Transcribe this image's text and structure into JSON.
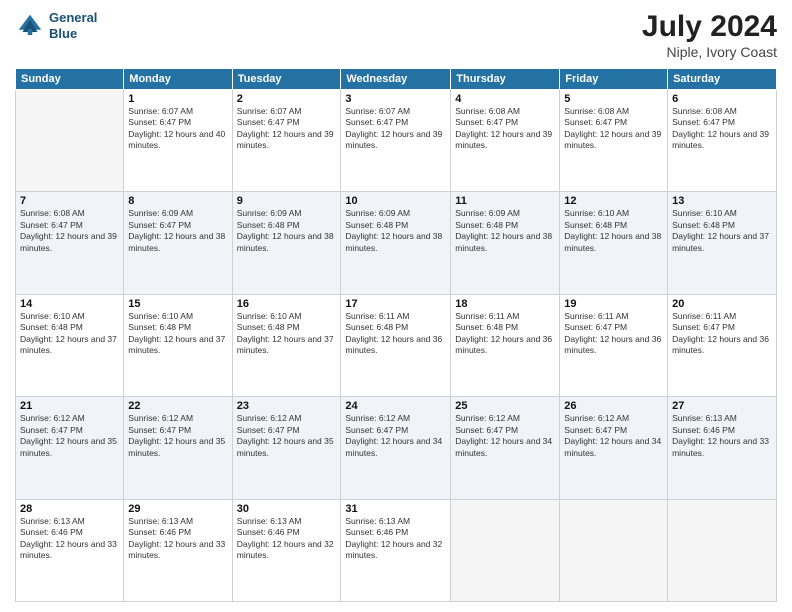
{
  "header": {
    "logo_line1": "General",
    "logo_line2": "Blue",
    "month_year": "July 2024",
    "location": "Niple, Ivory Coast"
  },
  "days_of_week": [
    "Sunday",
    "Monday",
    "Tuesday",
    "Wednesday",
    "Thursday",
    "Friday",
    "Saturday"
  ],
  "weeks": [
    [
      {
        "day": "",
        "sunrise": "",
        "sunset": "",
        "daylight": "",
        "empty": true
      },
      {
        "day": "1",
        "sunrise": "Sunrise: 6:07 AM",
        "sunset": "Sunset: 6:47 PM",
        "daylight": "Daylight: 12 hours and 40 minutes."
      },
      {
        "day": "2",
        "sunrise": "Sunrise: 6:07 AM",
        "sunset": "Sunset: 6:47 PM",
        "daylight": "Daylight: 12 hours and 39 minutes."
      },
      {
        "day": "3",
        "sunrise": "Sunrise: 6:07 AM",
        "sunset": "Sunset: 6:47 PM",
        "daylight": "Daylight: 12 hours and 39 minutes."
      },
      {
        "day": "4",
        "sunrise": "Sunrise: 6:08 AM",
        "sunset": "Sunset: 6:47 PM",
        "daylight": "Daylight: 12 hours and 39 minutes."
      },
      {
        "day": "5",
        "sunrise": "Sunrise: 6:08 AM",
        "sunset": "Sunset: 6:47 PM",
        "daylight": "Daylight: 12 hours and 39 minutes."
      },
      {
        "day": "6",
        "sunrise": "Sunrise: 6:08 AM",
        "sunset": "Sunset: 6:47 PM",
        "daylight": "Daylight: 12 hours and 39 minutes."
      }
    ],
    [
      {
        "day": "7",
        "sunrise": "Sunrise: 6:08 AM",
        "sunset": "Sunset: 6:47 PM",
        "daylight": "Daylight: 12 hours and 39 minutes."
      },
      {
        "day": "8",
        "sunrise": "Sunrise: 6:09 AM",
        "sunset": "Sunset: 6:47 PM",
        "daylight": "Daylight: 12 hours and 38 minutes."
      },
      {
        "day": "9",
        "sunrise": "Sunrise: 6:09 AM",
        "sunset": "Sunset: 6:48 PM",
        "daylight": "Daylight: 12 hours and 38 minutes."
      },
      {
        "day": "10",
        "sunrise": "Sunrise: 6:09 AM",
        "sunset": "Sunset: 6:48 PM",
        "daylight": "Daylight: 12 hours and 38 minutes."
      },
      {
        "day": "11",
        "sunrise": "Sunrise: 6:09 AM",
        "sunset": "Sunset: 6:48 PM",
        "daylight": "Daylight: 12 hours and 38 minutes."
      },
      {
        "day": "12",
        "sunrise": "Sunrise: 6:10 AM",
        "sunset": "Sunset: 6:48 PM",
        "daylight": "Daylight: 12 hours and 38 minutes."
      },
      {
        "day": "13",
        "sunrise": "Sunrise: 6:10 AM",
        "sunset": "Sunset: 6:48 PM",
        "daylight": "Daylight: 12 hours and 37 minutes."
      }
    ],
    [
      {
        "day": "14",
        "sunrise": "Sunrise: 6:10 AM",
        "sunset": "Sunset: 6:48 PM",
        "daylight": "Daylight: 12 hours and 37 minutes."
      },
      {
        "day": "15",
        "sunrise": "Sunrise: 6:10 AM",
        "sunset": "Sunset: 6:48 PM",
        "daylight": "Daylight: 12 hours and 37 minutes."
      },
      {
        "day": "16",
        "sunrise": "Sunrise: 6:10 AM",
        "sunset": "Sunset: 6:48 PM",
        "daylight": "Daylight: 12 hours and 37 minutes."
      },
      {
        "day": "17",
        "sunrise": "Sunrise: 6:11 AM",
        "sunset": "Sunset: 6:48 PM",
        "daylight": "Daylight: 12 hours and 36 minutes."
      },
      {
        "day": "18",
        "sunrise": "Sunrise: 6:11 AM",
        "sunset": "Sunset: 6:48 PM",
        "daylight": "Daylight: 12 hours and 36 minutes."
      },
      {
        "day": "19",
        "sunrise": "Sunrise: 6:11 AM",
        "sunset": "Sunset: 6:47 PM",
        "daylight": "Daylight: 12 hours and 36 minutes."
      },
      {
        "day": "20",
        "sunrise": "Sunrise: 6:11 AM",
        "sunset": "Sunset: 6:47 PM",
        "daylight": "Daylight: 12 hours and 36 minutes."
      }
    ],
    [
      {
        "day": "21",
        "sunrise": "Sunrise: 6:12 AM",
        "sunset": "Sunset: 6:47 PM",
        "daylight": "Daylight: 12 hours and 35 minutes."
      },
      {
        "day": "22",
        "sunrise": "Sunrise: 6:12 AM",
        "sunset": "Sunset: 6:47 PM",
        "daylight": "Daylight: 12 hours and 35 minutes."
      },
      {
        "day": "23",
        "sunrise": "Sunrise: 6:12 AM",
        "sunset": "Sunset: 6:47 PM",
        "daylight": "Daylight: 12 hours and 35 minutes."
      },
      {
        "day": "24",
        "sunrise": "Sunrise: 6:12 AM",
        "sunset": "Sunset: 6:47 PM",
        "daylight": "Daylight: 12 hours and 34 minutes."
      },
      {
        "day": "25",
        "sunrise": "Sunrise: 6:12 AM",
        "sunset": "Sunset: 6:47 PM",
        "daylight": "Daylight: 12 hours and 34 minutes."
      },
      {
        "day": "26",
        "sunrise": "Sunrise: 6:12 AM",
        "sunset": "Sunset: 6:47 PM",
        "daylight": "Daylight: 12 hours and 34 minutes."
      },
      {
        "day": "27",
        "sunrise": "Sunrise: 6:13 AM",
        "sunset": "Sunset: 6:46 PM",
        "daylight": "Daylight: 12 hours and 33 minutes."
      }
    ],
    [
      {
        "day": "28",
        "sunrise": "Sunrise: 6:13 AM",
        "sunset": "Sunset: 6:46 PM",
        "daylight": "Daylight: 12 hours and 33 minutes."
      },
      {
        "day": "29",
        "sunrise": "Sunrise: 6:13 AM",
        "sunset": "Sunset: 6:46 PM",
        "daylight": "Daylight: 12 hours and 33 minutes."
      },
      {
        "day": "30",
        "sunrise": "Sunrise: 6:13 AM",
        "sunset": "Sunset: 6:46 PM",
        "daylight": "Daylight: 12 hours and 32 minutes."
      },
      {
        "day": "31",
        "sunrise": "Sunrise: 6:13 AM",
        "sunset": "Sunset: 6:46 PM",
        "daylight": "Daylight: 12 hours and 32 minutes."
      },
      {
        "day": "",
        "sunrise": "",
        "sunset": "",
        "daylight": "",
        "empty": true
      },
      {
        "day": "",
        "sunrise": "",
        "sunset": "",
        "daylight": "",
        "empty": true
      },
      {
        "day": "",
        "sunrise": "",
        "sunset": "",
        "daylight": "",
        "empty": true
      }
    ]
  ]
}
